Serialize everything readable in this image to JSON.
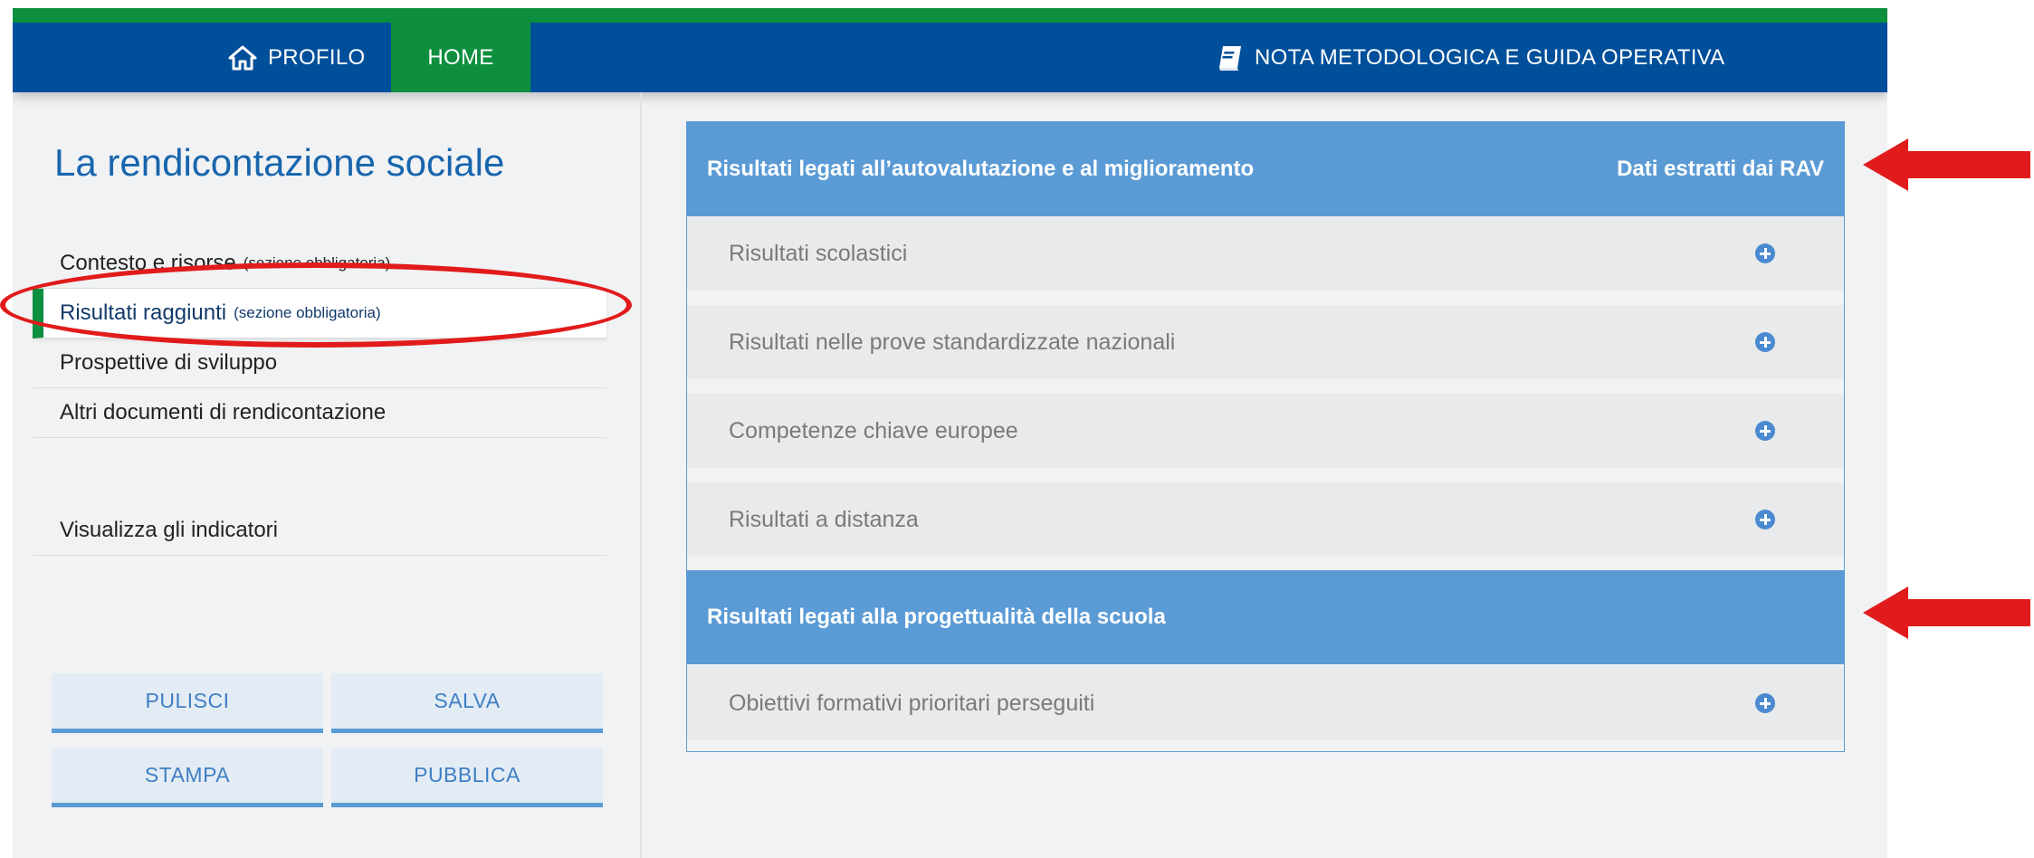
{
  "nav": {
    "profilo_label": "PROFILO",
    "home_label": "HOME",
    "guida_label": "NOTA METODOLOGICA E GUIDA OPERATIVA"
  },
  "sidebar": {
    "title": "La rendicontazione sociale",
    "items": [
      {
        "label": "Contesto e risorse",
        "note": "(sezione obbligatoria)"
      },
      {
        "label": "Risultati raggiunti",
        "note": "(sezione obbligatoria)"
      },
      {
        "label": "Prospettive di sviluppo",
        "note": ""
      },
      {
        "label": "Altri documenti di rendicontazione",
        "note": ""
      }
    ],
    "indicators_label": "Visualizza gli indicatori",
    "buttons": {
      "pulisci": "PULISCI",
      "salva": "SALVA",
      "stampa": "STAMPA",
      "pubblica": "PUBBLICA"
    }
  },
  "panel": {
    "section1": {
      "title": "Risultati legati all’autovalutazione e al miglioramento",
      "right_label": "Dati estratti dai RAV",
      "rows": [
        "Risultati scolastici",
        "Risultati nelle prove standardizzate nazionali",
        "Competenze chiave europee",
        "Risultati a distanza"
      ]
    },
    "section2": {
      "title": "Risultati legati alla progettualità della scuola",
      "rows": [
        "Obiettivi formativi prioritari perseguiti"
      ]
    }
  },
  "colors": {
    "nav_blue": "#004f9a",
    "green": "#0d8f3e",
    "panel_blue": "#5b9bd5",
    "annotation_red": "#e11b1b"
  },
  "icons": [
    "home-icon",
    "book-icon",
    "plus-circle-icon",
    "red-arrow-icon"
  ]
}
